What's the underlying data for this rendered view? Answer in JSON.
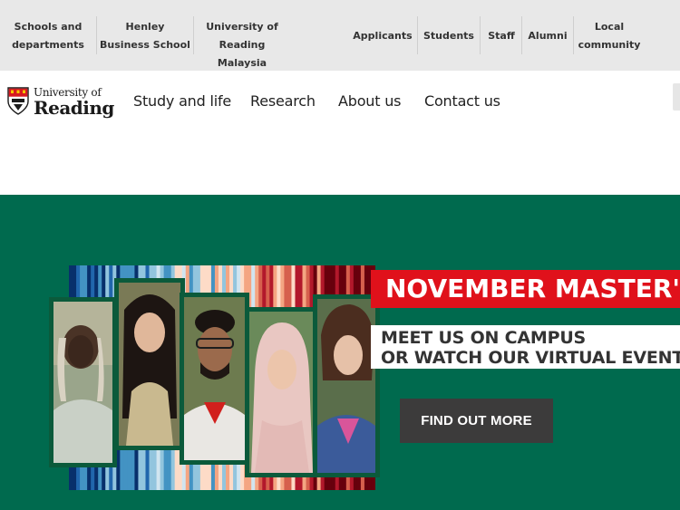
{
  "top_bar": {
    "left_links": [
      {
        "line1": "Schools and",
        "line2": "departments"
      },
      {
        "line1": "Henley",
        "line2": "Business School"
      },
      {
        "line1": "University of",
        "line2": "Reading Malaysia"
      }
    ],
    "right_links": [
      {
        "line1": "Applicants",
        "line2": ""
      },
      {
        "line1": "Students",
        "line2": ""
      },
      {
        "line1": "Staff",
        "line2": ""
      },
      {
        "line1": "Alumni",
        "line2": ""
      },
      {
        "line1": "Local",
        "line2": "community"
      }
    ]
  },
  "logo": {
    "line1": "University of",
    "line2": "Reading",
    "icon": "university-shield-icon"
  },
  "main_nav": [
    "Study and life",
    "Research",
    "About us",
    "Contact us"
  ],
  "hero": {
    "banner_title": "NOVEMBER MASTER'S",
    "subtitle_line1": "MEET US ON CAMPUS",
    "subtitle_line2": "OR WATCH OUR VIRTUAL EVENTS",
    "cta_label": "FIND OUT MORE",
    "people_photos": [
      "student-photo-1",
      "student-photo-2",
      "student-photo-3",
      "student-photo-4",
      "student-photo-5"
    ]
  },
  "colors": {
    "top_bar_bg": "#e8e8e8",
    "hero_green": "#006a4e",
    "banner_red": "#e0111b",
    "cta_bg": "#3c3b3b",
    "brand_red": "#d71920"
  }
}
